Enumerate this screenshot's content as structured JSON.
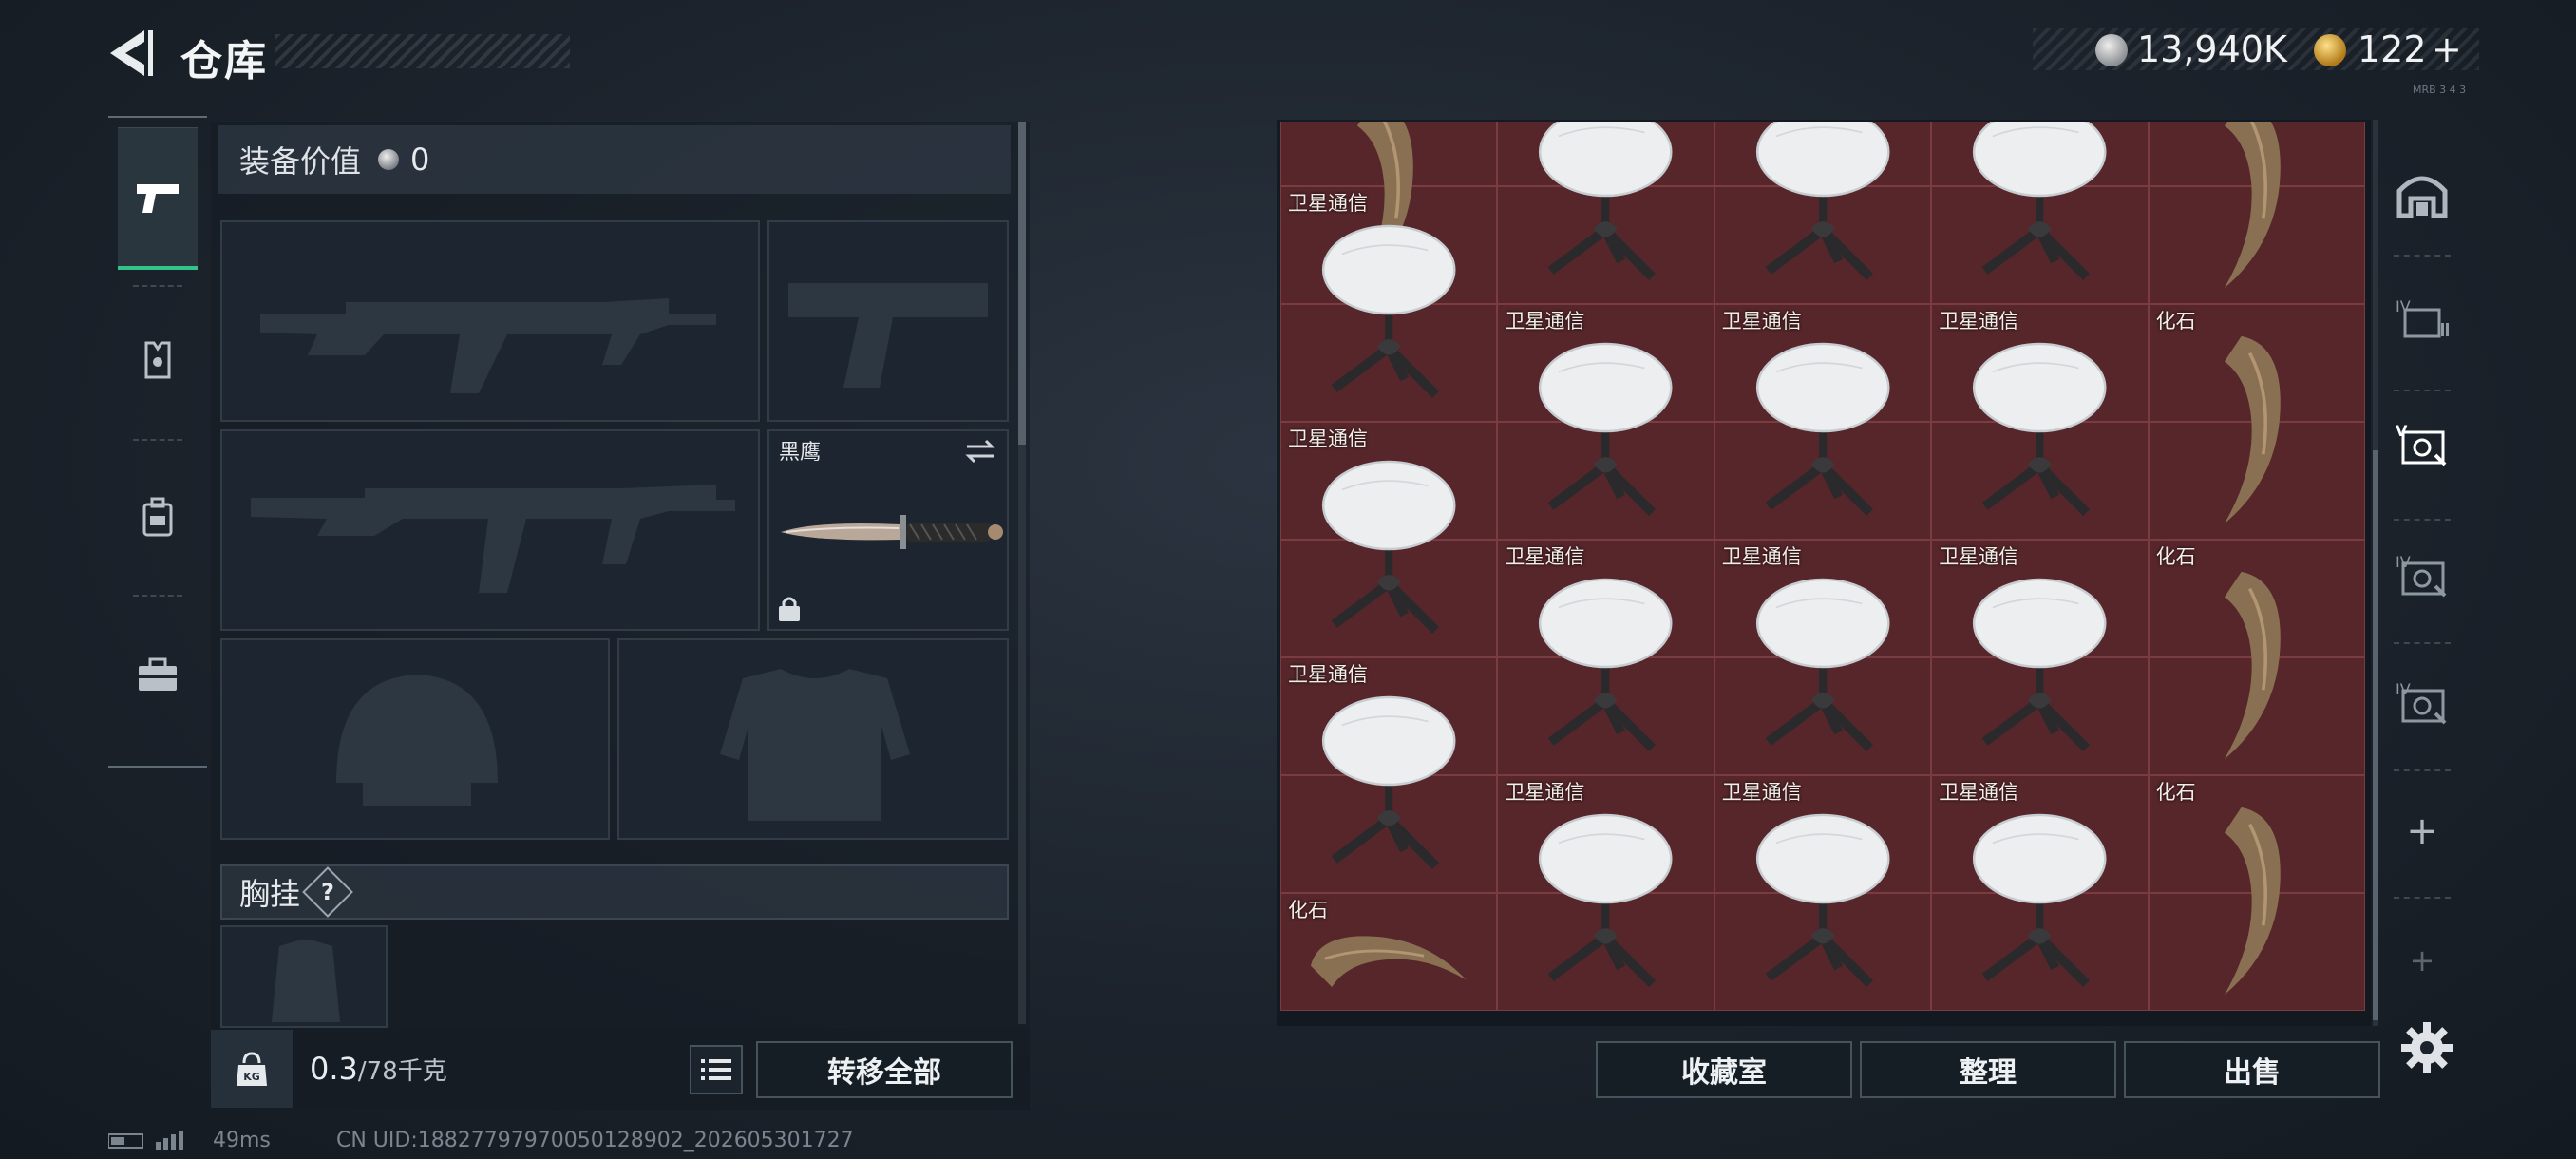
{
  "header": {
    "title": "仓库",
    "currency_silver": "13,940K",
    "currency_gold": "122",
    "gold_add": "+",
    "tiny_label": "MRB 3 4 3"
  },
  "equipment": {
    "value_label": "装备价值",
    "value_amount": "0",
    "knife_name": "黑鹰",
    "chest_rig_label": "胸挂",
    "help": "?"
  },
  "bottom": {
    "weight_current": "0.3",
    "weight_max": "/78千克",
    "transfer_all": "转移全部",
    "collection_room": "收藏室",
    "organize": "整理",
    "sell": "出售"
  },
  "stash": {
    "items": [
      {
        "name": "",
        "type": "claw",
        "row": 0,
        "col": 0
      },
      {
        "name": "",
        "type": "dish",
        "row": 0,
        "col": 1
      },
      {
        "name": "",
        "type": "dish",
        "row": 0,
        "col": 2
      },
      {
        "name": "",
        "type": "dish",
        "row": 0,
        "col": 3
      },
      {
        "name": "",
        "type": "claw",
        "row": 0,
        "col": 4
      },
      {
        "name": "卫星通信",
        "type": "dish",
        "row": 1,
        "col": 0
      },
      {
        "name": "卫星通信",
        "type": "dish",
        "row": 2,
        "col": 1
      },
      {
        "name": "卫星通信",
        "type": "dish",
        "row": 2,
        "col": 2
      },
      {
        "name": "卫星通信",
        "type": "dish",
        "row": 2,
        "col": 3
      },
      {
        "name": "化石",
        "type": "claw",
        "row": 2,
        "col": 4
      },
      {
        "name": "卫星通信",
        "type": "dish",
        "row": 3,
        "col": 0
      },
      {
        "name": "卫星通信",
        "type": "dish",
        "row": 4,
        "col": 1
      },
      {
        "name": "卫星通信",
        "type": "dish",
        "row": 4,
        "col": 2
      },
      {
        "name": "卫星通信",
        "type": "dish",
        "row": 4,
        "col": 3
      },
      {
        "name": "化石",
        "type": "claw",
        "row": 4,
        "col": 4
      },
      {
        "name": "卫星通信",
        "type": "dish",
        "row": 5,
        "col": 0
      },
      {
        "name": "卫星通信",
        "type": "dish",
        "row": 6,
        "col": 1
      },
      {
        "name": "卫星通信",
        "type": "dish",
        "row": 6,
        "col": 2
      },
      {
        "name": "卫星通信",
        "type": "dish",
        "row": 6,
        "col": 3
      },
      {
        "name": "化石",
        "type": "claw",
        "row": 6,
        "col": 4
      },
      {
        "name": "化石",
        "type": "claw-h",
        "row": 7,
        "col": 0
      }
    ]
  },
  "side_nav": {
    "add": "+",
    "tier_label": "IV"
  },
  "status": {
    "ping": "49ms",
    "uid": "CN UID:18827797970050128902_202605301727"
  },
  "colors": {
    "accent": "#33c28a",
    "stash_bg": "#56262a",
    "panel": "#1d2630"
  }
}
